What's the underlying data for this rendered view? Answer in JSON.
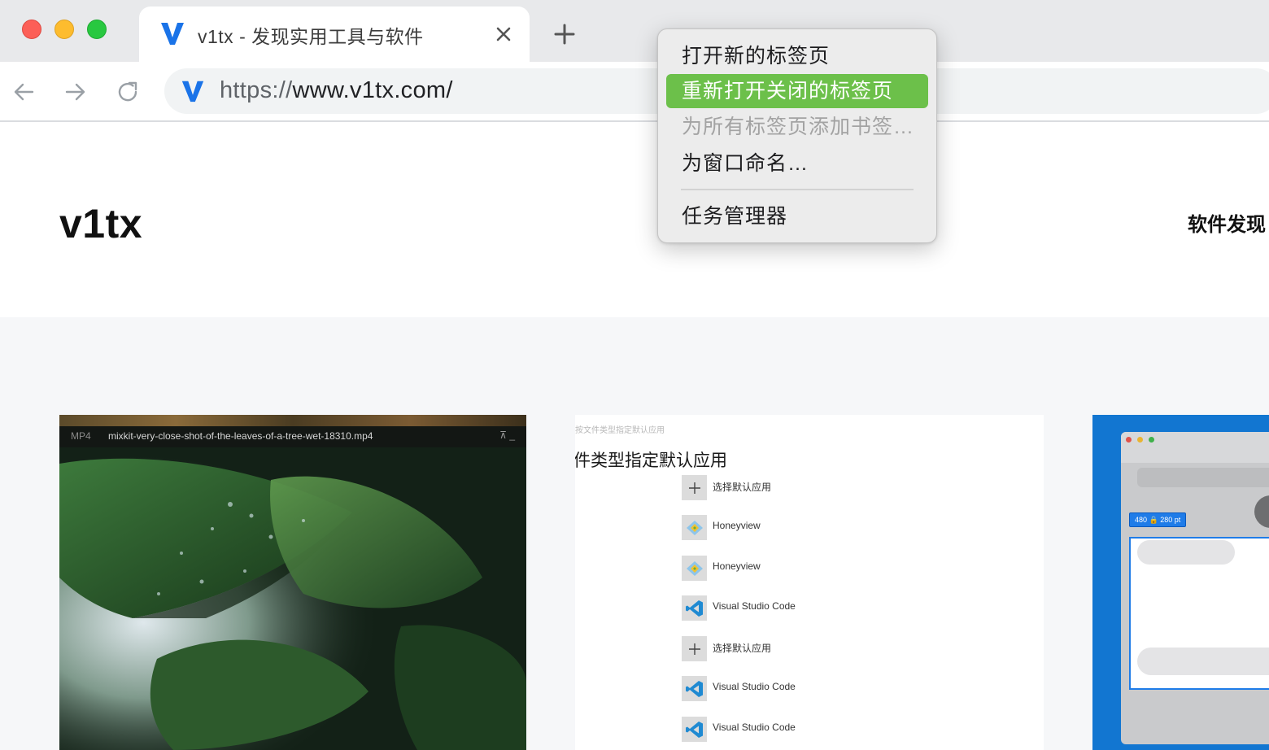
{
  "window": {
    "controls": [
      "close",
      "minimize",
      "maximize"
    ]
  },
  "tab": {
    "title": "v1tx - 发现实用工具与软件",
    "favicon": "v-logo-icon",
    "close_icon": "close-icon"
  },
  "newtab": {
    "icon": "plus-icon"
  },
  "toolbar": {
    "back_icon": "arrow-left-icon",
    "forward_icon": "arrow-right-icon",
    "reload_icon": "reload-icon",
    "url_proto": "https://",
    "url_rest": "www.v1tx.com/"
  },
  "site": {
    "logo": "v1tx",
    "nav_item": "软件发现"
  },
  "cards": {
    "video": {
      "badge": "MP4",
      "filename": "mixkit-very-close-shot-of-the-leaves-of-a-tree-wet-18310.mp4",
      "controls": "⊼  _"
    },
    "apps": {
      "breadcrumb": "按文件类型指定默认应用",
      "title": "件类型指定默认应用",
      "rows": [
        {
          "label": "选择默认应用",
          "icon": "plus-icon"
        },
        {
          "label": "Honeyview",
          "icon": "honeyview-icon"
        },
        {
          "label": "Honeyview",
          "icon": "honeyview-icon"
        },
        {
          "label": "Visual Studio Code",
          "icon": "vscode-icon"
        },
        {
          "label": "选择默认应用",
          "icon": "plus-icon"
        },
        {
          "label": "Visual Studio Code",
          "icon": "vscode-icon"
        },
        {
          "label": "Visual Studio Code",
          "icon": "vscode-icon"
        }
      ]
    },
    "mock": {
      "chip": "480 🔒 280 pt"
    }
  },
  "context_menu": {
    "items": [
      {
        "label": "打开新的标签页",
        "state": "normal"
      },
      {
        "label": "重新打开关闭的标签页",
        "state": "highlighted"
      },
      {
        "label": "为所有标签页添加书签…",
        "state": "disabled"
      },
      {
        "label": "为窗口命名…",
        "state": "normal"
      },
      {
        "label": "任务管理器",
        "state": "normal"
      }
    ]
  },
  "colors": {
    "tabstrip_bg": "#e8e9eb",
    "menu_highlight": "#6cc04a",
    "favicon_blue": "#1a73e8",
    "close_red": "#fc5f57",
    "min_yellow": "#fdbc2e",
    "max_green": "#28c840"
  }
}
